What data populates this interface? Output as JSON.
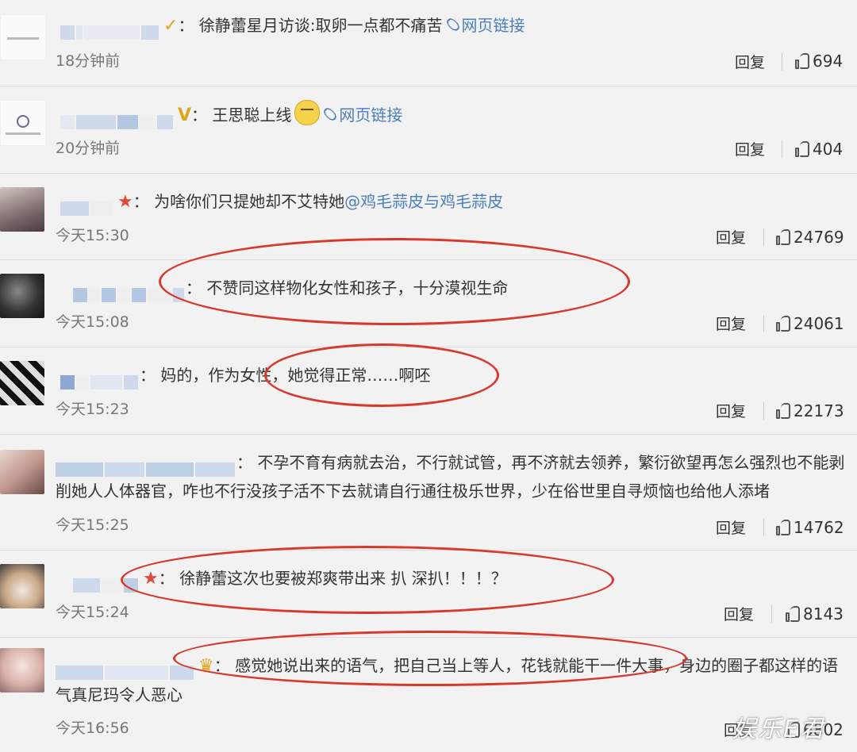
{
  "comments": [
    {
      "text": "徐静蕾星月访谈:取卵一点都不痛苦",
      "link": "网页链接",
      "time": "18分钟前",
      "reply": "回复",
      "likes": "694"
    },
    {
      "text": "王思聪上线",
      "link": "网页链接",
      "time": "20分钟前",
      "reply": "回复",
      "likes": "404"
    },
    {
      "text": "为啥你们只提她却不艾特她",
      "mention": "@鸡毛蒜皮与鸡毛蒜皮",
      "time": "今天15:30",
      "reply": "回复",
      "likes": "24769"
    },
    {
      "text": "不赞同这样物化女性和孩子，十分漠视生命",
      "time": "今天15:08",
      "reply": "回复",
      "likes": "24061"
    },
    {
      "text": "妈的，作为女性，她觉得正常……啊呸",
      "time": "今天15:23",
      "reply": "回复",
      "likes": "22173"
    },
    {
      "text": "不孕不育有病就去治，不行就试管，再不济就去领养，繁衍欲望再怎么强烈也不能剥削她人人体器官，咋也不行没孩子活不下去就请自行通往极乐世界，少在俗世里自寻烦恼也给他人添堵",
      "time": "今天15:25",
      "reply": "回复",
      "likes": "14762"
    },
    {
      "text": "徐静蕾这次也要被郑爽带出来 扒 深扒！！！？",
      "time": "今天15:24",
      "reply": "回复",
      "likes": "8143"
    },
    {
      "text": "感觉她说出来的语气，把自己当上等人，花钱就能干一件大事，身边的圈子都这样的语气真尼玛令人恶心",
      "time": "今天16:56",
      "reply": "回复",
      "likes": "6802"
    }
  ],
  "colon": "：",
  "watermark": "娱乐E君",
  "colors": {
    "link": "#4a7fbe",
    "annotation": "#d7392d",
    "background": "#f2f2f2"
  }
}
